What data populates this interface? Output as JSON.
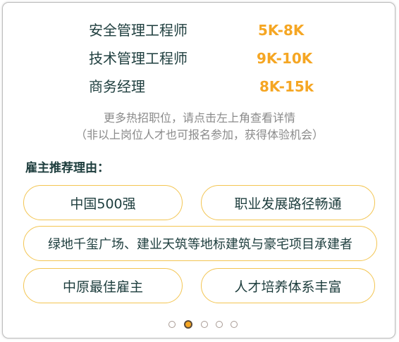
{
  "jobs": [
    {
      "title": "安全管理工程师",
      "salary": "5K-8K"
    },
    {
      "title": "技术管理工程师",
      "salary": "9K-10K"
    },
    {
      "title": "商务经理",
      "salary": "8K-15k"
    }
  ],
  "more_jobs": {
    "line1": "更多热招职位，请点击左上角查看详情",
    "line2": "（非以上岗位人才也可报名参加，获得体验机会）"
  },
  "reasons": {
    "title": "雇主推荐理由：",
    "items": [
      "中国500强",
      "职业发展路径畅通",
      "绿地千玺广场、建业天筑等地标建筑与豪宅项目承建者",
      "中原最佳雇主",
      "人才培养体系丰富"
    ]
  },
  "carousel": {
    "count": 5,
    "active_index": 1
  },
  "colors": {
    "accent": "#f5a623",
    "text": "#1d3d3d",
    "muted": "#8a8a8a",
    "pill_border": "#f3c552"
  }
}
